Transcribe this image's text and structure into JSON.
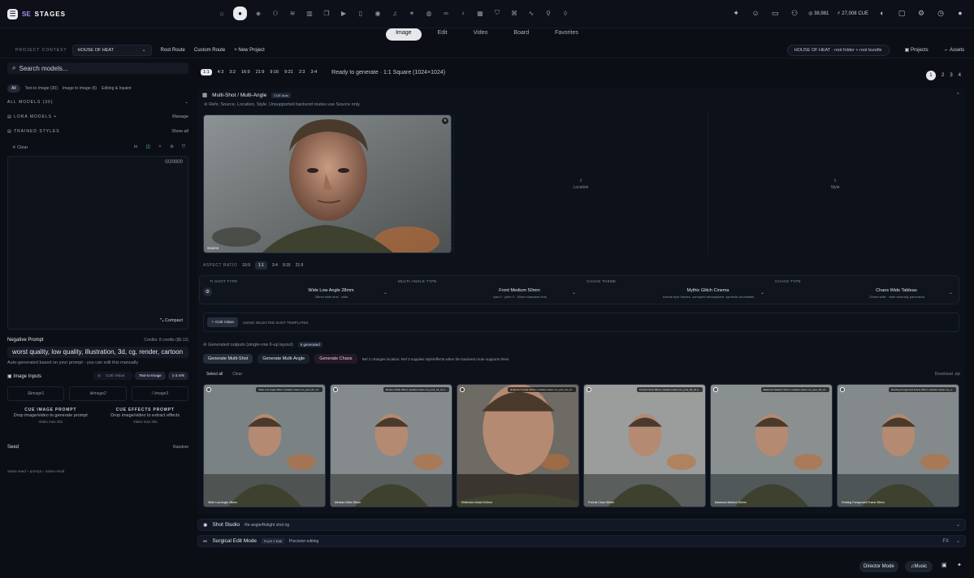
{
  "app": {
    "mark": "SE",
    "name": "STAGES"
  },
  "nav_icons": [
    "home-icon",
    "globe-icon",
    "layers-icon",
    "users-icon",
    "stack-icon",
    "film-icon",
    "copy-icon",
    "video-icon",
    "phone-icon",
    "eye-icon",
    "music-icon",
    "spark-icon",
    "ball-icon",
    "link-icon",
    "bulb-icon",
    "grid-icon",
    "shield-icon",
    "wand-icon",
    "activity-icon",
    "pin-icon",
    "badge-icon"
  ],
  "header_right": {
    "credits": "38,981",
    "cue": "27,008",
    "cue_unit": "CUE"
  },
  "mode_tabs": [
    "Image",
    "Edit",
    "Video",
    "Board",
    "Favorites"
  ],
  "active_mode": "Image",
  "project": {
    "context_label": "PROJECT CONTEXT",
    "selected": "HOUSE OF HEAT",
    "root_route": "Root Route",
    "custom_route": "Custom Route",
    "new_project": "New Project",
    "path_pill": "HOUSE OF HEAT · root folder + root bundle",
    "projects": "Projects",
    "assets": "Assets"
  },
  "sidebar": {
    "search_placeholder": "Search models...",
    "filters": [
      "All",
      "Text to Image (30)",
      "Image to Image (6)",
      "Editing & Inpaint"
    ],
    "all_models": "ALL MODELS (30)",
    "lora": "LORA MODELS",
    "lora_action": "Manage",
    "trained": "TRAINED STYLES",
    "trained_action": "Show all",
    "clear": "Clear",
    "prompt_count": "0/20000",
    "compact": "Compact",
    "negative_title": "Negative Prompt",
    "credits": "Credits: 8 credits ($0.12)",
    "negative_value": "worst quality, low quality, illustration, 3d, cg, render, cartoon",
    "auto": "Auto-generated based on your prompt - you can edit this manually",
    "image_inputs": "Image Inputs",
    "cue_vision": "CUE Vision",
    "text_to_image": "Text-to-Image",
    "refs": "1-3 refs",
    "slots": [
      "image1",
      "image2",
      "image3"
    ],
    "cue_image_title": "CUE IMAGE PROMPT",
    "cue_image_text": "Drop image/video to generate prompt",
    "cue_image_sub": "Video max 30s",
    "cue_fx_title": "CUE EFFECTS PROMPT",
    "cue_fx_text": "Drop image/video to extract effects",
    "cue_fx_sub": "Video max 30s",
    "seed": "Seed",
    "seed_mode": "Random",
    "seed_note": "Same seed + prompt = same result"
  },
  "ratios": [
    "1:1",
    "4:3",
    "3:2",
    "16:9",
    "21:9",
    "9:16",
    "9:21",
    "2:3",
    "3:4"
  ],
  "active_ratio": "1:1",
  "status": "Ready to generate · 1:1 Square (1024×1024)",
  "pages": [
    "1",
    "2",
    "3",
    "4"
  ],
  "panel": {
    "title": "Multi-Shot / Multi-Angle",
    "badge": "CUE Auto",
    "refs": "Refs: Source, Location, Style. Unsupported backend routes use Source only.",
    "source_label": "Source",
    "location_label": "Location",
    "style_label": "Style",
    "aspect_label": "ASPECT RATIO",
    "aspects": [
      "16:9",
      "1:1",
      "3:4",
      "9:16",
      "21:9"
    ],
    "shot_cols": [
      {
        "h": "TI-SHOT TYPE",
        "v": "Wide Low Angle 28mm",
        "s": "28mm wide lens · wide"
      },
      {
        "h": "MULTI-ANGLE TYPE",
        "v": "Front Medium 50mm",
        "s": "yaw 0 · pitch 0 · 50mm standard lens"
      },
      {
        "h": "CHAOS THEME",
        "v": "Mythic Glitch Cinema",
        "s": "surreal epic frames, corrupted atmosphere, symbolic anomalies"
      },
      {
        "h": "CHAOS TYPE",
        "v": "Chaos Wide Tableau",
        "s": "24mm wide · wide anomaly panorama"
      }
    ],
    "cue_vision_btn": "CUE Vision",
    "cue_vision_text": "USING SELECTED SHOT TEMPLATES",
    "generated_label": "Generated outputs (single-row 6-up layout)",
    "generated_count": "6 generated",
    "gen_buttons": [
      "Generate Multi-Shot",
      "Generate Multi-Angle",
      "Generate Chaos"
    ],
    "gen_note": "Ref 2 changes location; Ref 3 supplies style/effects when the backend route supports them.",
    "select_all": "Select all",
    "clear": "Clear",
    "download": "Download .zip",
    "thumbs": [
      {
        "cap": "Wide Low Angle 28mm",
        "top": "Wide Low Angle 28mm variation-token-ms_pool_01_ntl..."
      },
      {
        "cap": "Medium Wide 35mm",
        "top": "Medium Wide 35mm variation-token-ms_pool_13_ntl p..."
      },
      {
        "cap": "Reflection Detail 100mm",
        "top": "Reflection Detail 100mm variation-token-ms_pool_43_ntl..."
      },
      {
        "cap": "Portrait Close 85mm",
        "top": "Portrait Close 85mm variation-token-ms_pool_28_ntl p..."
      },
      {
        "cap": "Balanced Medium 50mm",
        "top": "Balanced Medium 50mm variation-token-ms_pool_18_ntl..."
      },
      {
        "cap": "Existing Foreground Frame 35mm",
        "top": "Existing Foreground Frame 35mm variation-token-ms_p..."
      }
    ]
  },
  "shot_studio": {
    "title": "Shot Studio",
    "sub": "Re-angle/Relight shot rig"
  },
  "surgical": {
    "title": "Surgical Edit Mode",
    "badge": "FLUX 2 Edit",
    "sub": "Precision editing",
    "fx": "FX"
  },
  "bottom": {
    "director": "Director Mode",
    "music": "Music"
  }
}
